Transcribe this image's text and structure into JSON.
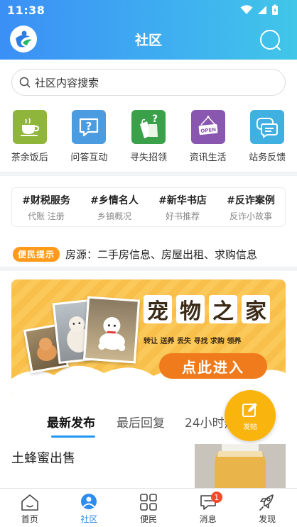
{
  "status_bar": {
    "time": "11:38"
  },
  "header": {
    "title": "社区"
  },
  "search": {
    "placeholder": "社区内容搜索"
  },
  "categories": [
    {
      "label": "茶余饭后",
      "icon": "coffee-cup-icon",
      "color": "#8fb53a"
    },
    {
      "label": "问答互动",
      "icon": "question-chat-icon",
      "color": "#4a9be0"
    },
    {
      "label": "寻失招领",
      "icon": "shopping-bag-question-icon",
      "color": "#3aa04a"
    },
    {
      "label": "资讯生活",
      "icon": "open-sign-icon",
      "color": "#8a57b0"
    },
    {
      "label": "站务反馈",
      "icon": "chat-bubbles-icon",
      "color": "#3fb0df"
    }
  ],
  "tags": [
    {
      "title": "#财税服务",
      "sub": "代账 注册"
    },
    {
      "title": "#乡情名人",
      "sub": "乡镇概况"
    },
    {
      "title": "#新华书店",
      "sub": "好书推荐"
    },
    {
      "title": "#反诈案例",
      "sub": "反诈小故事"
    }
  ],
  "notice": {
    "badge": "便民提示",
    "text": "房源：二手房信息、房屋出租、求购信息"
  },
  "banner": {
    "title_chars": [
      "宠",
      "物",
      "之",
      "家"
    ],
    "subtitle": "转让  送养    丢失 寻找    求购 领养",
    "button": "点此进入"
  },
  "tabs": [
    {
      "label": "最新发布",
      "active": true
    },
    {
      "label": "最后回复",
      "active": false
    },
    {
      "label": "24小时热",
      "active": false
    }
  ],
  "fab": {
    "label": "发帖"
  },
  "post": {
    "title": "土蜂蜜出售"
  },
  "bottom_nav": [
    {
      "label": "首页",
      "icon": "home-icon",
      "active": false
    },
    {
      "label": "社区",
      "icon": "community-icon",
      "active": true
    },
    {
      "label": "便民",
      "icon": "grid-icon",
      "active": false
    },
    {
      "label": "消息",
      "icon": "message-icon",
      "active": false,
      "badge": "1"
    },
    {
      "label": "发现",
      "icon": "rocket-icon",
      "active": false
    }
  ],
  "colors": {
    "accent": "#2196f3",
    "header_start": "#3b8ff5",
    "header_end": "#40c6e8",
    "fab": "#f9b40e",
    "notice_badge": "#ff9a1a"
  }
}
